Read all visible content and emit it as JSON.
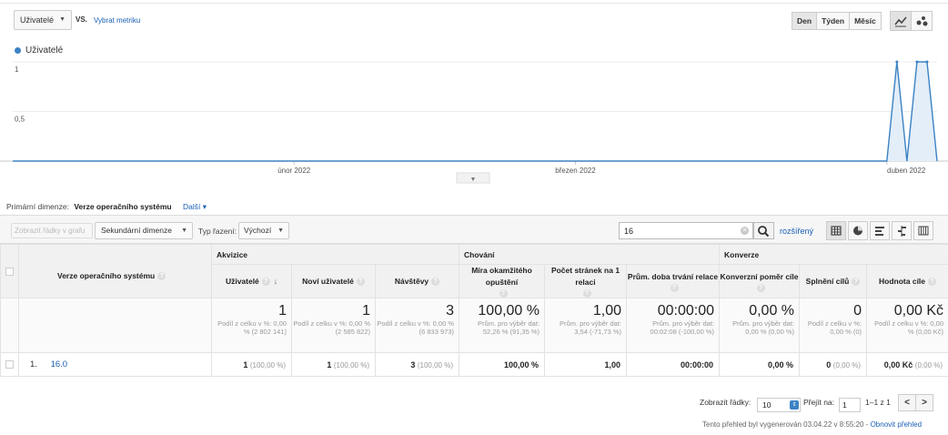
{
  "header": {
    "metric": "Uživatelé",
    "vs": "VS.",
    "pick_metric": "Vybrat metriku",
    "periods": [
      "Den",
      "Týden",
      "Měsíc"
    ],
    "active_period": "Den"
  },
  "chart_data": {
    "type": "line",
    "series": [
      {
        "name": "Uživatelé",
        "x": [
          "2022-01-04",
          "2022-04-01",
          "2022-04-02",
          "2022-04-03",
          "2022-04-04",
          "2022-04-05",
          "2022-04-06"
        ],
        "values": [
          0,
          0,
          1,
          0,
          1,
          1,
          0
        ]
      }
    ],
    "y_ticks": [
      "1",
      "0,5"
    ],
    "x_ticks": [
      "únor 2022",
      "březen 2022",
      "duben 2022"
    ],
    "ylim": [
      0,
      1
    ],
    "color": "#3b82c4",
    "fill": "#e3eef8"
  },
  "primary_dimension": {
    "label": "Primární dimenze:",
    "value": "Verze operačního systému",
    "more": "Další"
  },
  "toolbar": {
    "plot_rows": "Zobrazit řádky v grafu",
    "secondary_dimension": "Sekundární dimenze",
    "sort_label": "Typ řazení:",
    "sort_value": "Výchozí",
    "search_value": "16",
    "advanced": "rozšířený"
  },
  "table": {
    "dimension_header": "Verze operačního systému",
    "groups": [
      "Akvizice",
      "Chování",
      "Konverze"
    ],
    "columns": [
      "Uživatelé",
      "Noví uživatelé",
      "Návštěvy",
      "Míra okamžitého opuštění",
      "Počet stránek na 1 relaci",
      "Prům. doba trvání relace",
      "Konverzní poměr cíle",
      "Splnění cílů",
      "Hodnota cíle"
    ],
    "totals": [
      {
        "value": "1",
        "sub": "Podíl z celku v %: 0,00 % (2 802 141)"
      },
      {
        "value": "1",
        "sub": "Podíl z celku v %: 0,00 % (2 585 822)"
      },
      {
        "value": "3",
        "sub": "Podíl z celku v %: 0,00 % (6 833 973)"
      },
      {
        "value": "100,00 %",
        "sub": "Prům. pro výběr dat: 52,26 % (91,35 %)"
      },
      {
        "value": "1,00",
        "sub": "Prům. pro výběr dat: 3,54 (-71,73 %)"
      },
      {
        "value": "00:00:00",
        "sub": "Prům. pro výběr dat: 00:02:08 (-100,00 %)"
      },
      {
        "value": "0,00 %",
        "sub": "Prům. pro výběr dat: 0,00 % (0,00 %)"
      },
      {
        "value": "0",
        "sub": "Podíl z celku v %: 0,00 % (0)"
      },
      {
        "value": "0,00 Kč",
        "sub": "Podíl z celku v %: 0,00 % (0,00 Kč)"
      }
    ],
    "rows": [
      {
        "index": "1.",
        "dimension": "16.0",
        "cells": [
          {
            "main": "1",
            "pct": "(100,00 %)"
          },
          {
            "main": "1",
            "pct": "(100,00 %)"
          },
          {
            "main": "3",
            "pct": "(100,00 %)"
          },
          {
            "main": "100,00 %",
            "pct": ""
          },
          {
            "main": "1,00",
            "pct": ""
          },
          {
            "main": "00:00:00",
            "pct": ""
          },
          {
            "main": "0,00 %",
            "pct": ""
          },
          {
            "main": "0",
            "pct": "(0,00 %)"
          },
          {
            "main": "0,00 Kč",
            "pct": "(0,00 %)"
          }
        ]
      }
    ]
  },
  "pagination": {
    "show_rows_label": "Zobrazit řádky:",
    "show_rows_value": "10",
    "goto_label": "Přejít na:",
    "goto_value": "1",
    "range": "1–1 z 1",
    "prev": "<",
    "next": ">"
  },
  "footer": {
    "generated": "Tento přehled byl vygenerován 03.04.22 v 8:55:20 - ",
    "refresh": "Obnovit přehled"
  }
}
